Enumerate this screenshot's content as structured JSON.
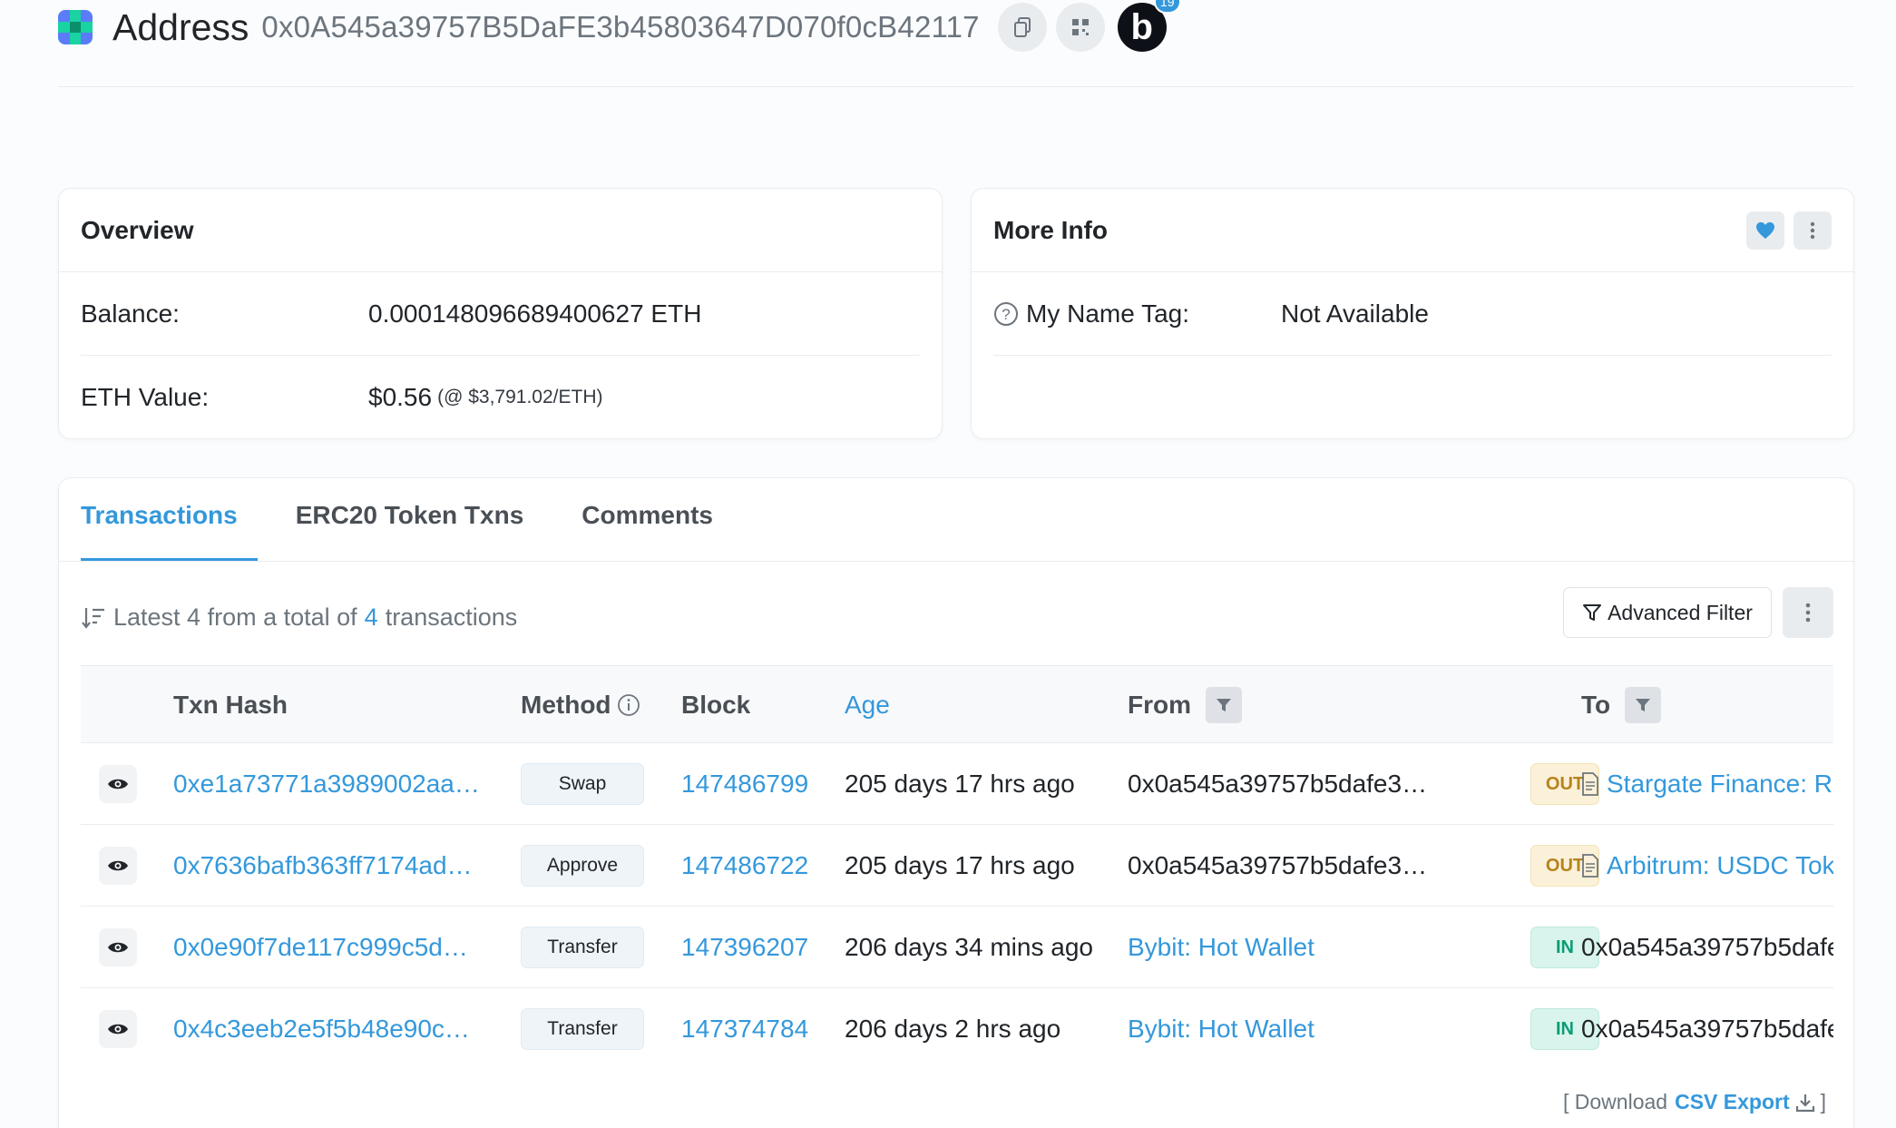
{
  "header": {
    "title": "Address",
    "address": "0x0A545a39757B5DaFE3b45803647D070f0cB42117",
    "badge_letter": "b",
    "badge_count": "19"
  },
  "overview": {
    "title": "Overview",
    "balance_label": "Balance:",
    "balance_value": "0.000148096689400627 ETH",
    "eth_value_label": "ETH Value:",
    "eth_value": "$0.56",
    "eth_price": "(@ $3,791.02/ETH)"
  },
  "more_info": {
    "title": "More Info",
    "name_tag_label": "My Name Tag:",
    "name_tag_value": "Not Available"
  },
  "tabs": [
    {
      "label": "Transactions",
      "active": true
    },
    {
      "label": "ERC20 Token Txns",
      "active": false
    },
    {
      "label": "Comments",
      "active": false
    }
  ],
  "summary": {
    "prefix": "Latest 4 from a total of",
    "count": "4",
    "suffix": "transactions"
  },
  "toolbar": {
    "advanced_filter": "Advanced Filter"
  },
  "table": {
    "headers": {
      "hash": "Txn Hash",
      "method": "Method",
      "block": "Block",
      "age": "Age",
      "from": "From",
      "to": "To"
    },
    "rows": [
      {
        "hash": "0xe1a73771a3989002aa…",
        "method": "Swap",
        "block": "147486799",
        "age": "205 days 17 hrs ago",
        "from": "0x0a545a39757b5dafe3…",
        "from_link": false,
        "dir": "OUT",
        "to": "Stargate Finance: R",
        "to_link": true
      },
      {
        "hash": "0x7636bafb363ff7174ad…",
        "method": "Approve",
        "block": "147486722",
        "age": "205 days 17 hrs ago",
        "from": "0x0a545a39757b5dafe3…",
        "from_link": false,
        "dir": "OUT",
        "to": "Arbitrum: USDC Tok",
        "to_link": true
      },
      {
        "hash": "0x0e90f7de117c999c5d…",
        "method": "Transfer",
        "block": "147396207",
        "age": "206 days 34 mins ago",
        "from": "Bybit: Hot Wallet",
        "from_link": true,
        "dir": "IN",
        "to": "0x0a545a39757b5dafe",
        "to_link": false
      },
      {
        "hash": "0x4c3eeb2e5f5b48e90c…",
        "method": "Transfer",
        "block": "147374784",
        "age": "206 days 2 hrs ago",
        "from": "Bybit: Hot Wallet",
        "from_link": true,
        "dir": "IN",
        "to": "0x0a545a39757b5dafe",
        "to_link": false
      }
    ]
  },
  "csv": {
    "open": "[ Download",
    "label": "CSV Export",
    "close": "]"
  },
  "colors": {
    "accent": "#3498db",
    "out_badge": "#b7821d",
    "in_badge": "#0a9d74"
  }
}
